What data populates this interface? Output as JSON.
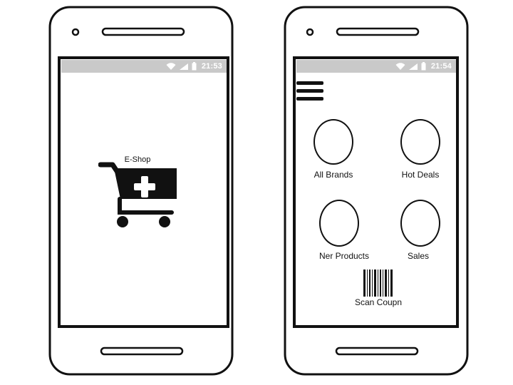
{
  "splash": {
    "status_time": "21:53",
    "app_name": "E-Shop"
  },
  "home": {
    "status_time": "21:54",
    "menu_icon": "hamburger-menu-icon",
    "tiles": [
      {
        "label": "All Brands"
      },
      {
        "label": "Hot Deals"
      },
      {
        "label": "Ner Products"
      },
      {
        "label": "Sales"
      }
    ],
    "scan_label": "Scan Coupn"
  }
}
